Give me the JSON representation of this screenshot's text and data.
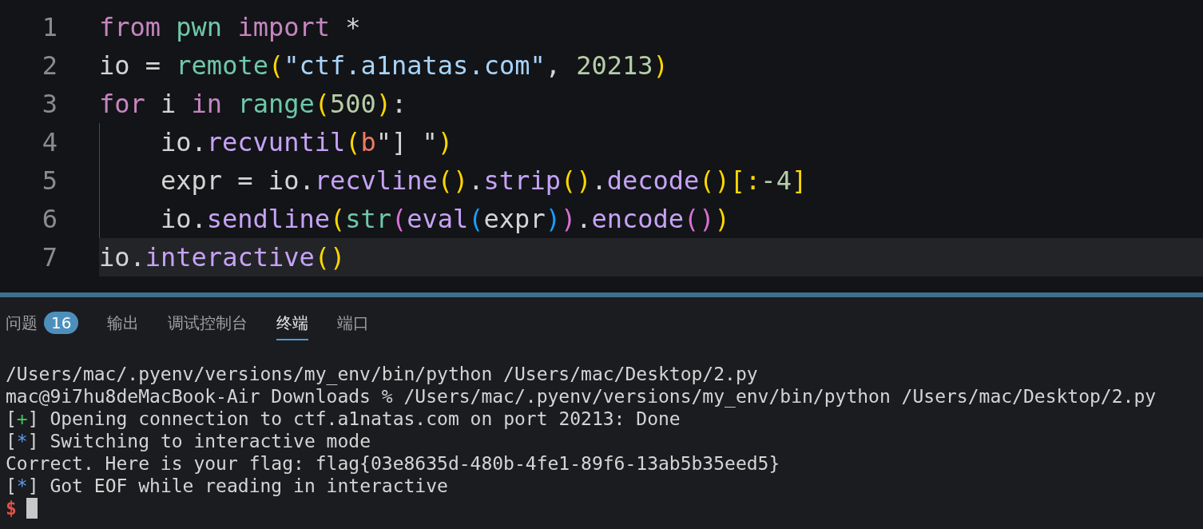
{
  "editor": {
    "lines": [
      {
        "number": "1",
        "current": false,
        "tokens": [
          {
            "text": "from",
            "kind": "keyword"
          },
          {
            "text": " pwn ",
            "kind": "name"
          },
          {
            "text": "import",
            "kind": "keyword"
          },
          {
            "text": " *",
            "kind": "plain"
          }
        ]
      },
      {
        "number": "2",
        "current": false,
        "tokens": [
          {
            "text": "io = ",
            "kind": "plain"
          },
          {
            "text": "remote",
            "kind": "name"
          },
          {
            "text": "(",
            "kind": "paren1"
          },
          {
            "text": "\"ctf.a1natas.com\"",
            "kind": "string"
          },
          {
            "text": ", ",
            "kind": "plain"
          },
          {
            "text": "20213",
            "kind": "number"
          },
          {
            "text": ")",
            "kind": "paren1"
          }
        ]
      },
      {
        "number": "3",
        "current": false,
        "tokens": [
          {
            "text": "for",
            "kind": "keyword"
          },
          {
            "text": " i ",
            "kind": "plain"
          },
          {
            "text": "in",
            "kind": "keyword"
          },
          {
            "text": " range",
            "kind": "name"
          },
          {
            "text": "(",
            "kind": "paren1"
          },
          {
            "text": "500",
            "kind": "number"
          },
          {
            "text": ")",
            "kind": "paren1"
          },
          {
            "text": ":",
            "kind": "plain"
          }
        ],
        "children": [
          {
            "number": "4",
            "current": false,
            "tokens": [
              {
                "text": "io.",
                "kind": "plain"
              },
              {
                "text": "recvuntil",
                "kind": "method"
              },
              {
                "text": "(",
                "kind": "paren1"
              },
              {
                "text": "b",
                "kind": "prefix"
              },
              {
                "text": "\"] \"",
                "kind": "plain"
              },
              {
                "text": ")",
                "kind": "paren1"
              }
            ]
          },
          {
            "number": "5",
            "current": false,
            "tokens": [
              {
                "text": "expr = io.",
                "kind": "plain"
              },
              {
                "text": "recvline",
                "kind": "method"
              },
              {
                "text": "()",
                "kind": "paren1"
              },
              {
                "text": ".",
                "kind": "plain"
              },
              {
                "text": "strip",
                "kind": "method"
              },
              {
                "text": "()",
                "kind": "paren1"
              },
              {
                "text": ".",
                "kind": "plain"
              },
              {
                "text": "decode",
                "kind": "method"
              },
              {
                "text": "()",
                "kind": "paren1"
              },
              {
                "text": "[:",
                "kind": "paren1"
              },
              {
                "text": "-4",
                "kind": "number"
              },
              {
                "text": "]",
                "kind": "paren1"
              }
            ]
          },
          {
            "number": "6",
            "current": false,
            "tokens": [
              {
                "text": "io.",
                "kind": "plain"
              },
              {
                "text": "sendline",
                "kind": "method"
              },
              {
                "text": "(",
                "kind": "paren1"
              },
              {
                "text": "str",
                "kind": "name"
              },
              {
                "text": "(",
                "kind": "paren2"
              },
              {
                "text": "eval",
                "kind": "method"
              },
              {
                "text": "(",
                "kind": "paren3"
              },
              {
                "text": "expr",
                "kind": "plain"
              },
              {
                "text": ")",
                "kind": "paren3"
              },
              {
                "text": ")",
                "kind": "paren2"
              },
              {
                "text": ".",
                "kind": "plain"
              },
              {
                "text": "encode",
                "kind": "method"
              },
              {
                "text": "()",
                "kind": "paren2"
              },
              {
                "text": ")",
                "kind": "paren1"
              }
            ]
          }
        ]
      },
      {
        "number": "7",
        "current": true,
        "tokens": [
          {
            "text": "io.",
            "kind": "plain"
          },
          {
            "text": "interactive",
            "kind": "method"
          },
          {
            "text": "()",
            "kind": "paren1"
          }
        ]
      }
    ]
  },
  "panel": {
    "tabs": [
      {
        "label": "问题",
        "badge": "16",
        "selected": false
      },
      {
        "label": "输出",
        "selected": false
      },
      {
        "label": "调试控制台",
        "selected": false
      },
      {
        "label": "终端",
        "selected": true
      },
      {
        "label": "端口",
        "selected": false
      }
    ],
    "terminal": {
      "lines": [
        [
          {
            "text": "/Users/mac/.pyenv/versions/my_env/bin/python /Users/mac/Desktop/2.py",
            "kind": "plain"
          }
        ],
        [
          {
            "text": "mac@9i7hu8deMacBook-Air Downloads % /Users/mac/.pyenv/versions/my_env/bin/python /Users/mac/Desktop/2.py",
            "kind": "plain"
          }
        ],
        [
          {
            "text": "[",
            "kind": "plain"
          },
          {
            "text": "+",
            "kind": "success"
          },
          {
            "text": "] Opening connection to ctf.a1natas.com on port 20213: Done",
            "kind": "plain"
          }
        ],
        [
          {
            "text": "[",
            "kind": "plain"
          },
          {
            "text": "*",
            "kind": "info"
          },
          {
            "text": "] Switching to interactive mode",
            "kind": "plain"
          }
        ],
        [
          {
            "text": "Correct. Here is your flag: flag{03e8635d-480b-4fe1-89f6-13ab5b35eed5}",
            "kind": "plain"
          }
        ],
        [
          {
            "text": "[",
            "kind": "plain"
          },
          {
            "text": "*",
            "kind": "info"
          },
          {
            "text": "] Got EOF while reading in interactive",
            "kind": "plain"
          }
        ]
      ],
      "prompt": "$"
    }
  }
}
